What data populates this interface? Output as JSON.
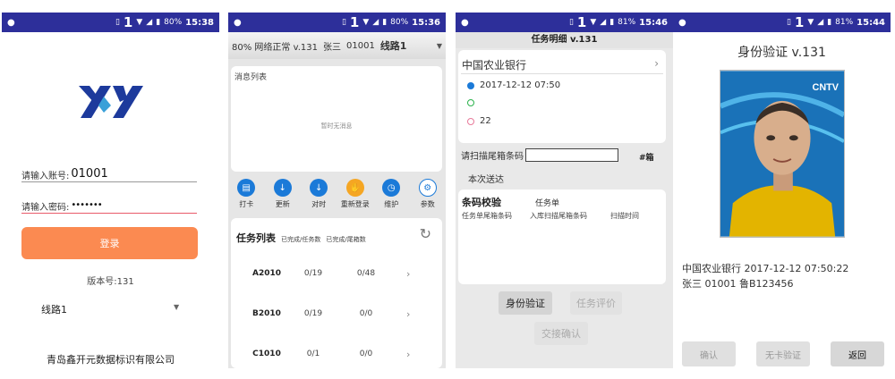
{
  "status": [
    {
      "battery": "80%",
      "time": "15:38"
    },
    {
      "battery": "80%",
      "time": "15:36"
    },
    {
      "battery": "81%",
      "time": "15:46"
    },
    {
      "battery": "81%",
      "time": "15:44"
    }
  ],
  "login": {
    "account_label": "请输入账号:",
    "account_value": "01001",
    "password_label": "请输入密码:",
    "password_value": "•••••••",
    "login_button": "登录",
    "version": "版本号:131",
    "route": "线路1",
    "company": "青岛鑫开元数据标识有限公司",
    "logo_color": "#1d3a9c"
  },
  "main": {
    "header": {
      "network": "80% 网络正常 v.131",
      "user": "张三",
      "id": "01001",
      "route": "线路1"
    },
    "messages": {
      "title": "消息列表",
      "empty": "暂时无消息"
    },
    "tools": [
      {
        "icon": "card-icon",
        "label": "打卡"
      },
      {
        "icon": "update-icon",
        "label": "更新"
      },
      {
        "icon": "sync-time-icon",
        "label": "对时"
      },
      {
        "icon": "relogin-icon",
        "label": "重新登录"
      },
      {
        "icon": "maintain-icon",
        "label": "维护"
      },
      {
        "icon": "settings-icon",
        "label": "参数"
      }
    ],
    "tasks": {
      "title": "任务列表",
      "col_done_tasks": "已完成/任务数",
      "col_done_boxes": "已完成/尾箱数",
      "rows": [
        {
          "id": "A2010",
          "tasks": "0/19",
          "boxes": "0/48"
        },
        {
          "id": "B2010",
          "tasks": "0/19",
          "boxes": "0/0"
        },
        {
          "id": "C1010",
          "tasks": "0/1",
          "boxes": "0/0"
        }
      ]
    }
  },
  "detail": {
    "title": "任务明细  v.131",
    "bank": "中国农业银行",
    "datetime": "2017-12-12 07:50",
    "count": "22",
    "scan_label": "请扫描尾箱条码",
    "box_label": "#箱",
    "deliver": "本次送达",
    "check_title": "条码校验",
    "check_sub": "任务单",
    "col1": "任务单尾箱条码",
    "col2": "入库扫描尾箱条码",
    "col3": "扫描时间",
    "btn_identity": "身份验证",
    "btn_evaluate": "任务评价",
    "btn_handover": "交接确认"
  },
  "identity": {
    "title": "身份验证  v.131",
    "bank_line": "中国农业银行  2017-12-12 07:50:22",
    "person_line": "张三 01001 鲁B123456",
    "photo_tag": "CNTV",
    "btn_confirm": "确认",
    "btn_no_card": "无卡验证",
    "btn_back": "返回"
  }
}
